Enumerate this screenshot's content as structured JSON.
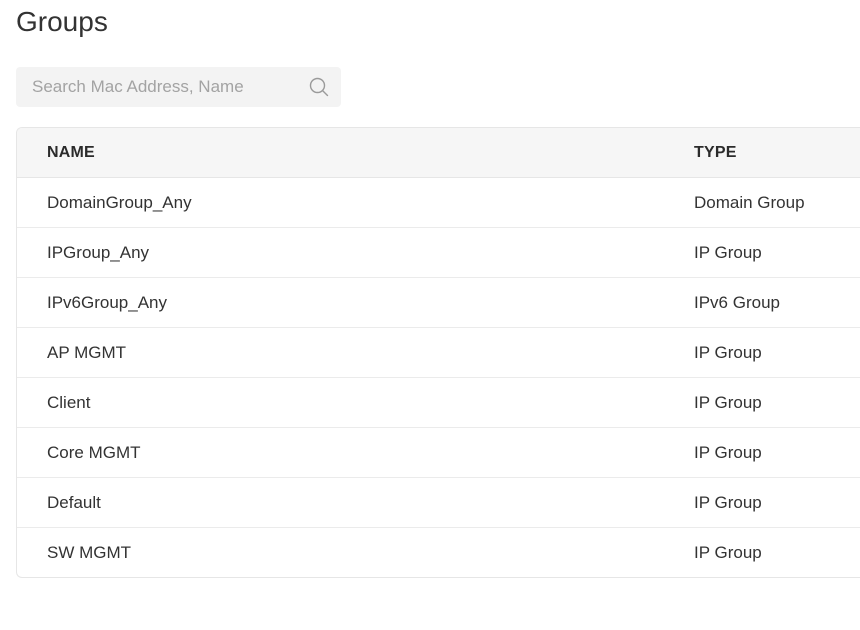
{
  "page": {
    "title": "Groups"
  },
  "search": {
    "placeholder": "Search Mac Address, Name",
    "value": "",
    "icon": "search-icon"
  },
  "table": {
    "columns": [
      {
        "label": "NAME"
      },
      {
        "label": "TYPE"
      }
    ],
    "rows": [
      {
        "name": "DomainGroup_Any",
        "type": "Domain Group"
      },
      {
        "name": "IPGroup_Any",
        "type": "IP Group"
      },
      {
        "name": "IPv6Group_Any",
        "type": "IPv6 Group"
      },
      {
        "name": "AP MGMT",
        "type": "IP Group"
      },
      {
        "name": "Client",
        "type": "IP Group"
      },
      {
        "name": "Core MGMT",
        "type": "IP Group"
      },
      {
        "name": "Default",
        "type": "IP Group"
      },
      {
        "name": "SW MGMT",
        "type": "IP Group"
      }
    ]
  },
  "colors": {
    "search_bg": "#f3f3f3",
    "header_bg": "#f6f6f6",
    "border": "#e6e6e6",
    "text": "#333333",
    "placeholder": "#a3a3a3"
  }
}
